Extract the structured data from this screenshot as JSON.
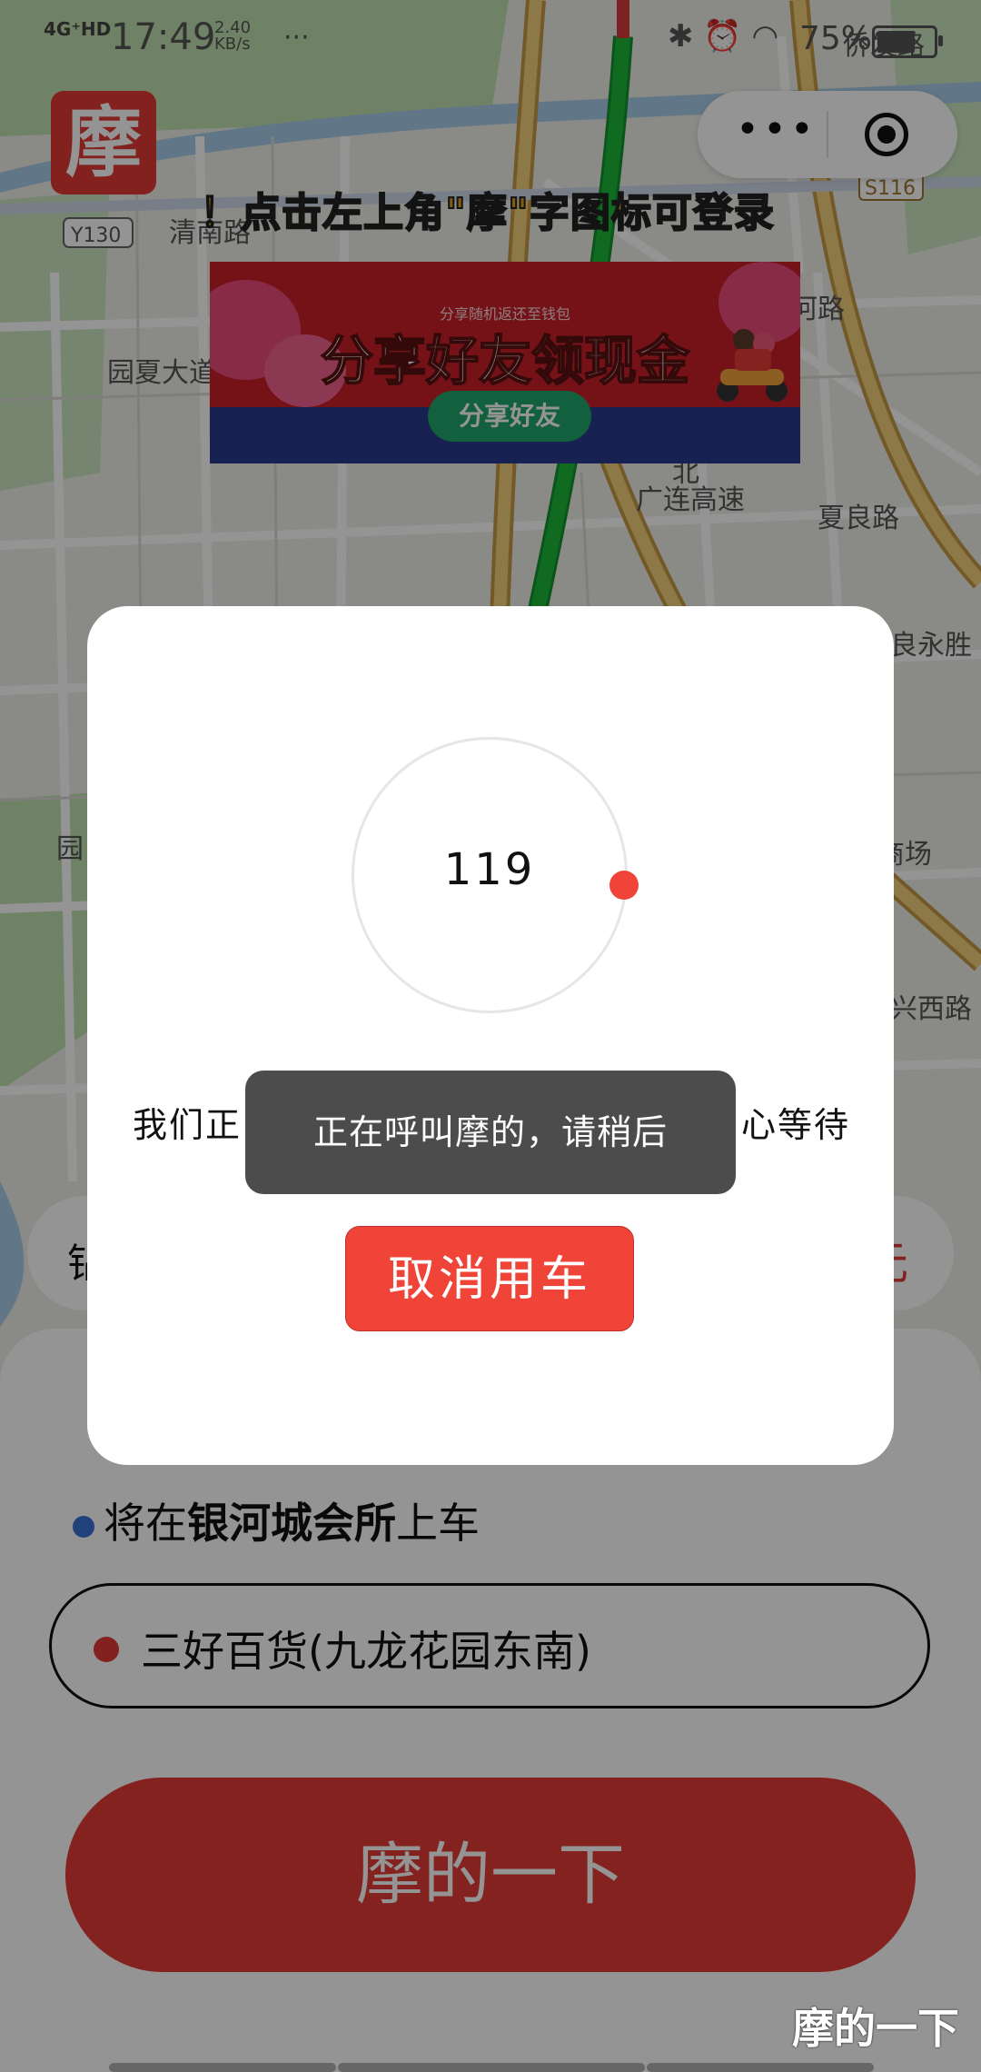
{
  "status_bar": {
    "network": "4G⁺HD",
    "time": "17:49",
    "speed_value": "2.40",
    "speed_unit": "KB/s",
    "dots": "···",
    "battery_text": "75%",
    "battery_level": 0.75
  },
  "logo": {
    "glyph": "摩"
  },
  "capsule": {
    "more": "•••"
  },
  "login_tip": "！点击左上角\"摩\"字图标可登录",
  "banner": {
    "subtitle": "分享随机返还至钱包",
    "title": "分享好友领现金",
    "button": "分享好友"
  },
  "map": {
    "labels": [
      "Y130",
      "清南路",
      "园夏大道",
      "S116",
      "侨发路",
      "河路",
      "夏良路",
      "广连高速",
      "良永胜",
      "商场",
      "兴西路",
      "北",
      "园",
      "钻"
    ],
    "route_color": "#1db83a",
    "road_color": "#f3cf7a"
  },
  "modal": {
    "countdown": "119",
    "wait_left": "我们正",
    "wait_right": "心等待",
    "cancel": "取消用车"
  },
  "toast": "正在呼叫摩的，请稍后",
  "panel": {
    "pickup_prefix": "将在",
    "pickup_place": "银河城会所",
    "pickup_suffix": "上车",
    "destination": "三好百货(九龙花园东南)",
    "call_button": "摩的一下",
    "side_pill_right": "元"
  },
  "bottom_label": "摩的一下",
  "colors": {
    "primary": "#e03a35",
    "accent_red": "#f04438",
    "pickup_blue": "#3b73d6"
  }
}
